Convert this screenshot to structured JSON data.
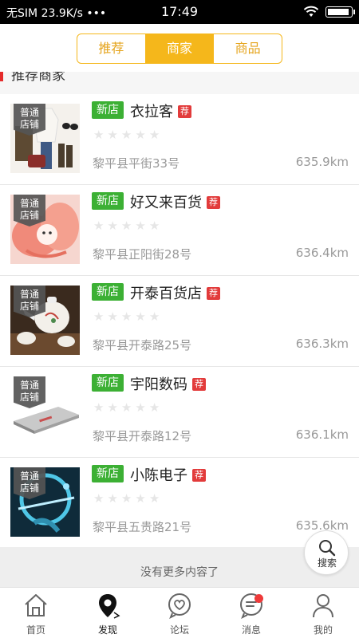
{
  "status_bar": {
    "carrier": "无SIM",
    "speed": "23.9K/s",
    "dots": "•••",
    "time": "17:49"
  },
  "top_tabs": [
    {
      "label": "推荐",
      "active": false
    },
    {
      "label": "商家",
      "active": true
    },
    {
      "label": "商品",
      "active": false
    }
  ],
  "section": {
    "title": "推荐商家"
  },
  "shop_badge": "普通\n店铺",
  "stores": [
    {
      "tag": "新店",
      "name": "衣拉客",
      "rec": "荐",
      "rating": 0,
      "address": "黎平县平街33号",
      "distance": "635.9km",
      "image": "clothing-photo"
    },
    {
      "tag": "新店",
      "name": "好又来百货",
      "rec": "荐",
      "rating": 0,
      "address": "黎平县正阳街28号",
      "distance": "636.4km",
      "image": "pink-toy-photo"
    },
    {
      "tag": "新店",
      "name": "开泰百货店",
      "rec": "荐",
      "rating": 0,
      "address": "黎平县开泰路25号",
      "distance": "636.3km",
      "image": "tea-set-photo"
    },
    {
      "tag": "新店",
      "name": "宇阳数码",
      "rec": "荐",
      "rating": 0,
      "address": "黎平县开泰路12号",
      "distance": "636.1km",
      "image": "hard-drive-photo"
    },
    {
      "tag": "新店",
      "name": "小陈电子",
      "rec": "荐",
      "rating": 0,
      "address": "黎平县五贵路21号",
      "distance": "635.6km",
      "image": "tech-photo"
    }
  ],
  "footer": {
    "no_more": "没有更多内容了"
  },
  "search_fab": {
    "label": "搜索"
  },
  "bottom_nav": [
    {
      "label": "首页",
      "icon": "home-icon"
    },
    {
      "label": "发现",
      "icon": "location-icon"
    },
    {
      "label": "论坛",
      "icon": "heart-chat-icon"
    },
    {
      "label": "消息",
      "icon": "message-icon"
    },
    {
      "label": "我的",
      "icon": "user-icon"
    }
  ],
  "colors": {
    "accent": "#f5b71b",
    "new_tag": "#3cb034",
    "rec_tag": "#e23b3b",
    "badge_dot": "#ee3a3a"
  }
}
